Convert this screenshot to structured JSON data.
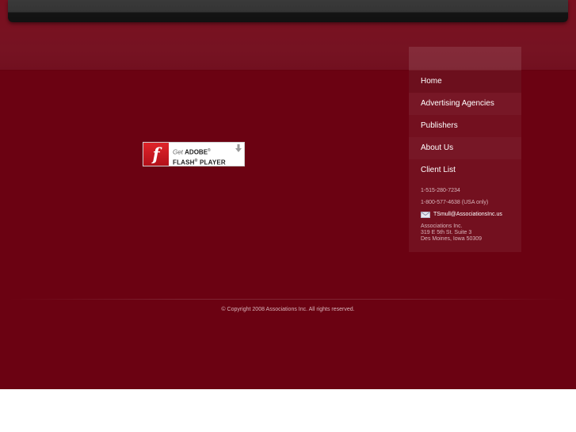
{
  "header": {},
  "flash_badge": {
    "get_label": "Get",
    "brand_label": "ADOBE",
    "product_label": "FLASH",
    "product_suffix": "PLAYER",
    "logo_glyph": "f"
  },
  "nav": {
    "items": [
      {
        "label": "Home"
      },
      {
        "label": "Advertising Agencies"
      },
      {
        "label": "Publishers"
      },
      {
        "label": "About Us"
      },
      {
        "label": "Client List"
      }
    ]
  },
  "contact": {
    "phone_local": "1-515-280-7234",
    "phone_tollfree": "1-800-577-4638 (USA only)",
    "email": "TSmull@AssociationsInc.us",
    "company": "Associations Inc.",
    "street": "319 E 5th St. Suite 3",
    "city": "Des Moines, Iowa 50309"
  },
  "footer": {
    "copyright": "© Copyright 2008 Associations Inc. All rights reserved."
  },
  "colors": {
    "background": "#6b0212",
    "header_bar": "#343434",
    "flash_red": "#d01c24"
  },
  "icons": {
    "flash_logo": "flash-logo-icon",
    "download_arrow": "download-arrow-icon",
    "mail": "mail-icon"
  }
}
